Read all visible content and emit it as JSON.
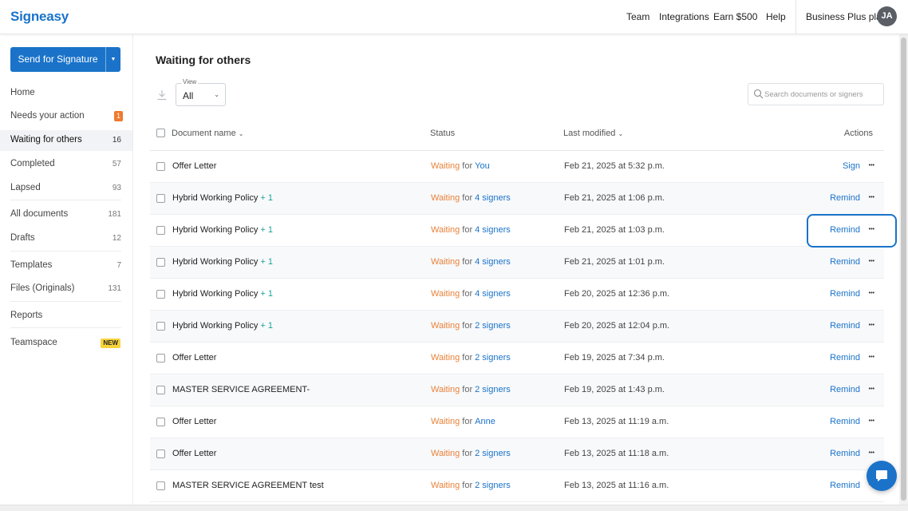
{
  "header": {
    "logo": "Signeasy",
    "nav": [
      "Team",
      "Integrations",
      "Earn $500",
      "Help"
    ],
    "plan": "Business Plus plan",
    "avatar_initials": "JA"
  },
  "sidebar": {
    "send_button": "Send for Signature",
    "items": [
      {
        "label": "Home",
        "count": ""
      },
      {
        "label": "Needs your action",
        "badge": "1"
      },
      {
        "label": "Waiting for others",
        "count": "16"
      },
      {
        "label": "Completed",
        "count": "57"
      },
      {
        "label": "Lapsed",
        "count": "93"
      },
      {
        "label": "All documents",
        "count": "181"
      },
      {
        "label": "Drafts",
        "count": "12"
      },
      {
        "label": "Templates",
        "count": "7"
      },
      {
        "label": "Files (Originals)",
        "count": "131"
      },
      {
        "label": "Reports",
        "count": ""
      },
      {
        "label": "Teamspace",
        "badge_new": "NEW"
      }
    ]
  },
  "main": {
    "title": "Waiting for others",
    "view_label": "View",
    "view_value": "All",
    "search_placeholder": "Search documents or signers",
    "columns": {
      "name": "Document name",
      "status": "Status",
      "modified": "Last modified",
      "actions": "Actions"
    },
    "rows": [
      {
        "name": "Offer Letter",
        "extra": "",
        "waiting": "Waiting",
        "for": "for",
        "who": "You",
        "modified": "Feb 21, 2025 at 5:32 p.m.",
        "action": "Sign"
      },
      {
        "name": "Hybrid Working Policy",
        "extra": "+ 1",
        "waiting": "Waiting",
        "for": "for",
        "who": "4 signers",
        "modified": "Feb 21, 2025 at 1:06 p.m.",
        "action": "Remind"
      },
      {
        "name": "Hybrid Working Policy",
        "extra": "+ 1",
        "waiting": "Waiting",
        "for": "for",
        "who": "4 signers",
        "modified": "Feb 21, 2025 at 1:03 p.m.",
        "action": "Remind"
      },
      {
        "name": "Hybrid Working Policy",
        "extra": "+ 1",
        "waiting": "Waiting",
        "for": "for",
        "who": "4 signers",
        "modified": "Feb 21, 2025 at 1:01 p.m.",
        "action": "Remind"
      },
      {
        "name": "Hybrid Working Policy",
        "extra": "+ 1",
        "waiting": "Waiting",
        "for": "for",
        "who": "4 signers",
        "modified": "Feb 20, 2025 at 12:36 p.m.",
        "action": "Remind"
      },
      {
        "name": "Hybrid Working Policy",
        "extra": "+ 1",
        "waiting": "Waiting",
        "for": "for",
        "who": "2 signers",
        "modified": "Feb 20, 2025 at 12:04 p.m.",
        "action": "Remind"
      },
      {
        "name": "Offer Letter",
        "extra": "",
        "waiting": "Waiting",
        "for": "for",
        "who": "2 signers",
        "modified": "Feb 19, 2025 at 7:34 p.m.",
        "action": "Remind"
      },
      {
        "name": "MASTER SERVICE AGREEMENT-",
        "extra": "",
        "waiting": "Waiting",
        "for": "for",
        "who": "2 signers",
        "modified": "Feb 19, 2025 at 1:43 p.m.",
        "action": "Remind"
      },
      {
        "name": "Offer Letter",
        "extra": "",
        "waiting": "Waiting",
        "for": "for",
        "who": "Anne",
        "modified": "Feb 13, 2025 at 11:19 a.m.",
        "action": "Remind"
      },
      {
        "name": "Offer Letter",
        "extra": "",
        "waiting": "Waiting",
        "for": "for",
        "who": "2 signers",
        "modified": "Feb 13, 2025 at 11:18 a.m.",
        "action": "Remind"
      },
      {
        "name": "MASTER SERVICE AGREEMENT test",
        "extra": "",
        "waiting": "Waiting",
        "for": "for",
        "who": "2 signers",
        "modified": "Feb 13, 2025 at 11:16 a.m.",
        "action": "Remind"
      }
    ]
  },
  "colors": {
    "brand": "#1a73c9",
    "waiting": "#e8823a",
    "extra": "#1aa39a",
    "badge": "#f07a2e",
    "new_badge": "#f7d33b"
  }
}
